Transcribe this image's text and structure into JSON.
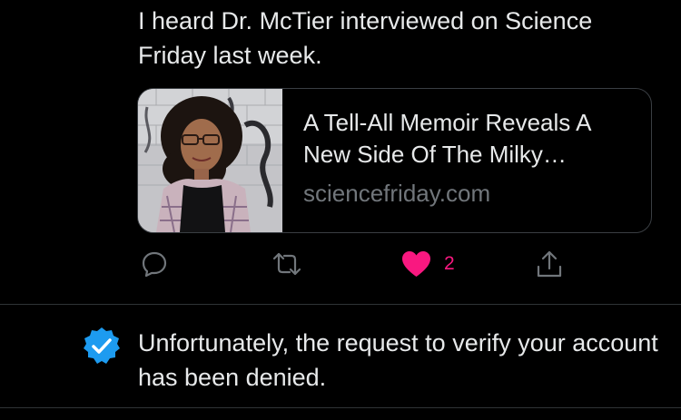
{
  "tweet": {
    "text": "I heard Dr. McTier interviewed on Science\nFriday last week.",
    "card": {
      "title": "A Tell-All Memoir Reveals A New Side Of The Milky…",
      "domain": "sciencefriday.com",
      "thumbnail": "portrait-photo"
    },
    "actions": {
      "reply_icon": "speech-bubble-icon",
      "retweet_icon": "retweet-arrows-icon",
      "like_icon": "heart-icon",
      "like_count": "2",
      "share_icon": "share-upload-icon"
    }
  },
  "notice": {
    "icon": "verified-badge-icon",
    "text": "Unfortunately, the request to verify your account has been denied."
  },
  "colors": {
    "background": "#000000",
    "text": "#e7e9ea",
    "secondary_text": "#71767b",
    "like": "#f91880",
    "verified": "#1d9bf0",
    "border": "#2f3336"
  }
}
